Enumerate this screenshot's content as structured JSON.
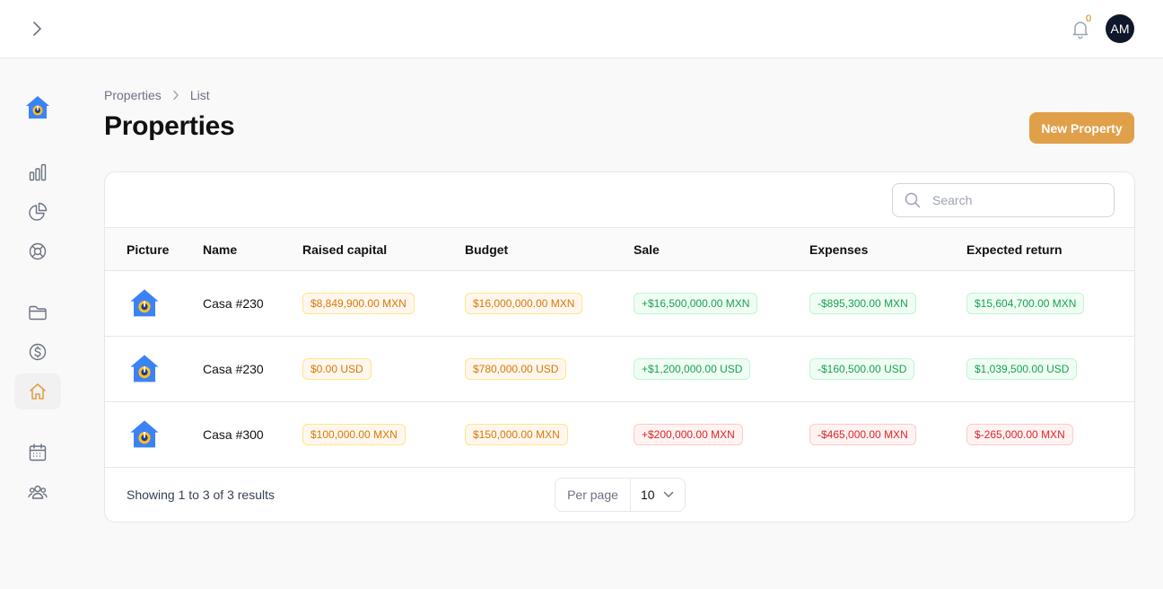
{
  "header": {
    "notification_count": "0",
    "user_initials": "AM"
  },
  "sidebar": {
    "items": [
      {
        "icon": "bar-chart-icon",
        "active": false
      },
      {
        "icon": "pie-chart-icon",
        "active": false
      },
      {
        "icon": "support-icon",
        "active": false
      },
      {
        "icon": "folder-icon",
        "active": false
      },
      {
        "icon": "dollar-icon",
        "active": false
      },
      {
        "icon": "home-icon",
        "active": true
      },
      {
        "icon": "calendar-icon",
        "active": false
      },
      {
        "icon": "users-icon",
        "active": false
      }
    ]
  },
  "breadcrumb": {
    "parent": "Properties",
    "current": "List"
  },
  "page": {
    "title": "Properties",
    "new_button": "New Property"
  },
  "search": {
    "placeholder": "Search"
  },
  "table": {
    "columns": [
      "Picture",
      "Name",
      "Raised capital",
      "Budget",
      "Sale",
      "Expenses",
      "Expected return"
    ],
    "rows": [
      {
        "name": "Casa #230",
        "raised_capital": "$8,849,900.00 MXN",
        "budget": "$16,000,000.00 MXN",
        "sale": "+$16,500,000.00 MXN",
        "expenses": "-$895,300.00 MXN",
        "expected_return": "$15,604,700.00 MXN",
        "sale_status": "success",
        "expenses_status": "success",
        "return_status": "success"
      },
      {
        "name": "Casa #230",
        "raised_capital": "$0.00 USD",
        "budget": "$780,000.00 USD",
        "sale": "+$1,200,000.00 USD",
        "expenses": "-$160,500.00 USD",
        "expected_return": "$1,039,500.00 USD",
        "sale_status": "success",
        "expenses_status": "success",
        "return_status": "success"
      },
      {
        "name": "Casa #300",
        "raised_capital": "$100,000.00 MXN",
        "budget": "$150,000.00 MXN",
        "sale": "+$200,000.00 MXN",
        "expenses": "-$465,000.00 MXN",
        "expected_return": "$-265,000.00 MXN",
        "sale_status": "danger",
        "expenses_status": "danger",
        "return_status": "danger"
      }
    ]
  },
  "pagination": {
    "summary": "Showing 1 to 3 of 3 results",
    "per_page_label": "Per page",
    "per_page_value": "10"
  },
  "colors": {
    "accent": "#e0a04a",
    "warning": "#d97706",
    "success": "#16a34a",
    "danger": "#dc2626"
  }
}
